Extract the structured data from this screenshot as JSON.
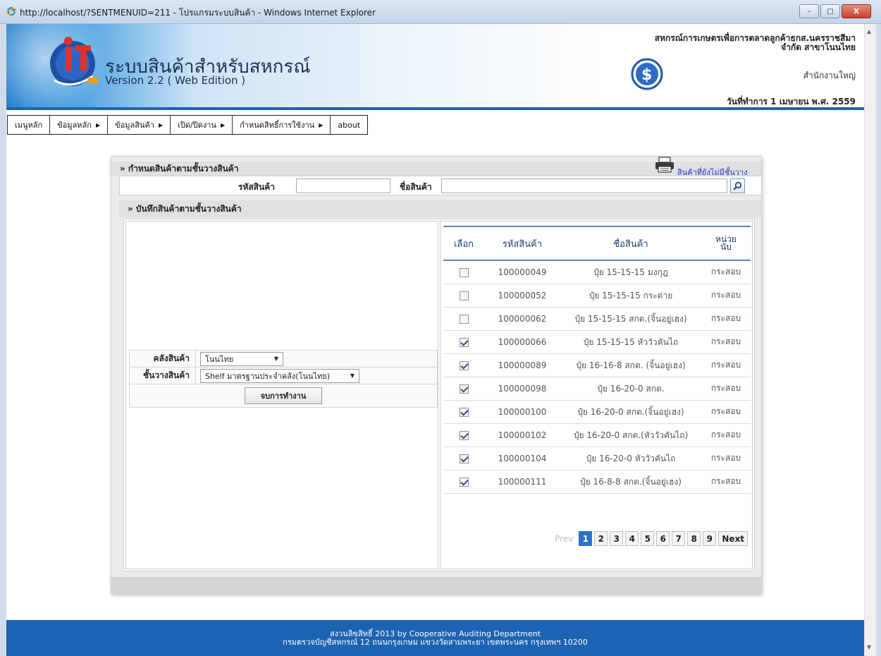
{
  "window": {
    "title": "http://localhost/?SENTMENUID=211 - โปรแกรมระบบสินค้า - Windows Internet Explorer",
    "buttons": [
      "–",
      "□",
      "X"
    ]
  },
  "header": {
    "app_title": "ระบบสินค้าสำหรับสหกรณ์",
    "version": "Version 2.2 ( Web Edition )",
    "org_line1": "สหกรณ์การเกษตรเพื่อการตลาดลูกค้าธกส.นครราชสีมา",
    "org_line2": "จำกัด สาขาโนนไทย",
    "branch": "สำนักงานใหญ่",
    "work_date": "วันที่ทำการ 1 เมษายน พ.ศ. 2559"
  },
  "menu": [
    {
      "label": "เมนูหลัก",
      "has_sub": false
    },
    {
      "label": "ข้อมูลหลัก",
      "has_sub": true
    },
    {
      "label": "ข้อมูลสินค้า",
      "has_sub": true
    },
    {
      "label": "เปิด/ปิดงาน",
      "has_sub": true
    },
    {
      "label": "กำหนดสิทธิ์การใช้งาน",
      "has_sub": true
    },
    {
      "label": "about",
      "has_sub": false
    }
  ],
  "panel": {
    "title": "» กำหนดสินค้าตามชั้นวางสินค้า",
    "noshelf_link": "สินค้าที่ยังไม่มีชั้นวาง",
    "search": {
      "code_label": "รหัสสินค้า",
      "code_value": "",
      "name_label": "ชื่อสินค้า",
      "name_value": ""
    },
    "subtitle": "» บันทึกสินค้าตามชั้นวางสินค้า",
    "form": {
      "warehouse_label": "คลังสินค้า",
      "warehouse_value": "โนนไทย",
      "shelf_label": "ชั้นวางสินค้า",
      "shelf_value": "Shelf มาตรฐานประจำคลัง(โนนไทย)",
      "end_button": "จบการทำงาน"
    },
    "grid": {
      "headers": {
        "select": "เลือก",
        "code": "รหัสสินค้า",
        "name": "ชื่อสินค้า",
        "unit_line1": "หน่วย",
        "unit_line2": "นับ"
      },
      "rows": [
        {
          "checked": false,
          "code": "100000049",
          "name": "ปุ๋ย 15-15-15 มงกุฎ",
          "unit": "กระสอบ"
        },
        {
          "checked": false,
          "code": "100000052",
          "name": "ปุ๋ย 15-15-15 กระต่าย",
          "unit": "กระสอบ"
        },
        {
          "checked": false,
          "code": "100000062",
          "name": "ปุ๋ย 15-15-15 สกต.(จิ้นอยู่เฮง)",
          "unit": "กระสอบ"
        },
        {
          "checked": true,
          "code": "100000066",
          "name": "ปุ๋ย 15-15-15 หัววัวคันไถ",
          "unit": "กระสอบ"
        },
        {
          "checked": true,
          "code": "100000089",
          "name": "ปุ๋ย 16-16-8 สกต. (จิ้นอยู่เฮง)",
          "unit": "กระสอบ"
        },
        {
          "checked": true,
          "code": "100000098",
          "name": "ปุ๋ย 16-20-0 สกต.",
          "unit": "กระสอบ"
        },
        {
          "checked": true,
          "code": "100000100",
          "name": "ปุ๋ย 16-20-0 สกต.(จิ้นอยู่เฮง)",
          "unit": "กระสอบ"
        },
        {
          "checked": true,
          "code": "100000102",
          "name": "ปุ๋ย 16-20-0 สกต.(หัววัวคันไถ)",
          "unit": "กระสอบ"
        },
        {
          "checked": true,
          "code": "100000104",
          "name": "ปุ๋ย 16-20-0 หัววัวคันไถ",
          "unit": "กระสอบ"
        },
        {
          "checked": true,
          "code": "100000111",
          "name": "ปุ๋ย 16-8-8 สกต.(จิ้นอยู่เฮง)",
          "unit": "กระสอบ"
        }
      ],
      "pager": {
        "prev": "Prev",
        "pages": [
          "1",
          "2",
          "3",
          "4",
          "5",
          "6",
          "7",
          "8",
          "9"
        ],
        "current": "1",
        "next": "Next"
      }
    }
  },
  "footer": {
    "line1": "สงวนลิขสิทธิ์ 2013 by Cooperative Auditing Department",
    "line2": "กรมตรวจบัญชีสหกรณ์ 12 ถนนกรุงเกษม แขวงวัดสามพระยา เขตพระนคร กรุงเทพฯ 10200"
  },
  "colors": {
    "accent_blue": "#1d63b3",
    "link_blue": "#1a3cc8",
    "pager_current": "#2b72c9"
  }
}
